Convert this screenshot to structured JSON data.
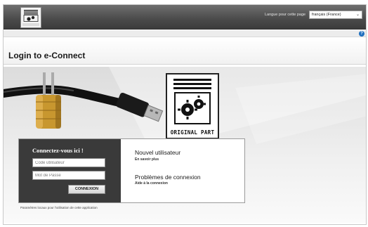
{
  "header": {
    "logo_caption": "ORIGINAL PART",
    "language_label": "Langue pour cette page",
    "language_selected": "français (France)"
  },
  "help": {
    "icon_glyph": "?"
  },
  "page_title": "Login to e-Connect",
  "badge": {
    "caption": "ORIGINAL PART"
  },
  "login": {
    "heading": "Connectez-vous ici !",
    "user_placeholder": "Code utilisateur",
    "password_placeholder": "Mot de Passe",
    "submit_label": "CONNEXION"
  },
  "links": {
    "new_user": {
      "title": "Nouvel utilisateur",
      "subtitle": "En savoir plus"
    },
    "problems": {
      "title": "Problèmes de connexion",
      "subtitle": "Aide à la connexion"
    }
  },
  "footer_note": "Paramètres locaux pour l'utilisation de cette application",
  "colors": {
    "header_bg": "#4a4a4a",
    "login_panel_bg": "#3a3a3a",
    "help_icon": "#1f6fbf",
    "usb_plug": "#b8b8b8",
    "brass_lock": "#c8972f"
  },
  "icons": [
    "original-part-logo-icon",
    "help-icon",
    "usb-cable-icon",
    "padlock-icon",
    "chevron-down-icon"
  ]
}
